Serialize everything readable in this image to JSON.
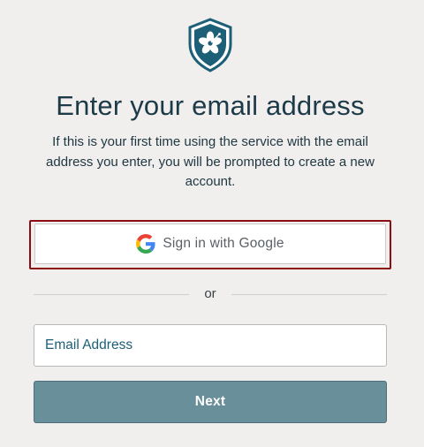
{
  "logo": {
    "icon": "hibiscus-shield-icon",
    "color": "#1c5f76"
  },
  "heading": "Enter your email address",
  "description": "If this is your first time using the service with the email address you enter, you will be prompted to create a new account.",
  "google_button": {
    "label": "Sign in with Google",
    "icon": "google-g-icon",
    "focus_color": "#8d0d14"
  },
  "divider": {
    "text": "or"
  },
  "email_field": {
    "placeholder": "Email Address",
    "value": ""
  },
  "next_button": {
    "label": "Next",
    "color": "#698f9b"
  }
}
